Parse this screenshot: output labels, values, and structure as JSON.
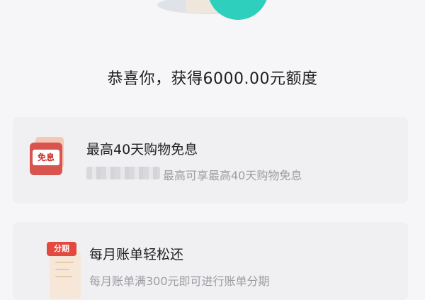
{
  "header": {
    "congrats_text": "恭喜你，获得6000.00元额度"
  },
  "benefits": [
    {
      "icon": "mianxi-icon",
      "badge": "免息",
      "title": "最高40天购物免息",
      "description": "最高可享最高40天购物免息"
    },
    {
      "icon": "fenqi-icon",
      "badge": "分期",
      "title": "每月账单轻松还",
      "description": "每月账单满300元即可进行账单分期"
    }
  ],
  "colors": {
    "accent_teal": "#2ecfbd",
    "badge_red": "#d9534f",
    "card_bg": "#f0f0f2",
    "muted_text": "#9d9da3"
  }
}
